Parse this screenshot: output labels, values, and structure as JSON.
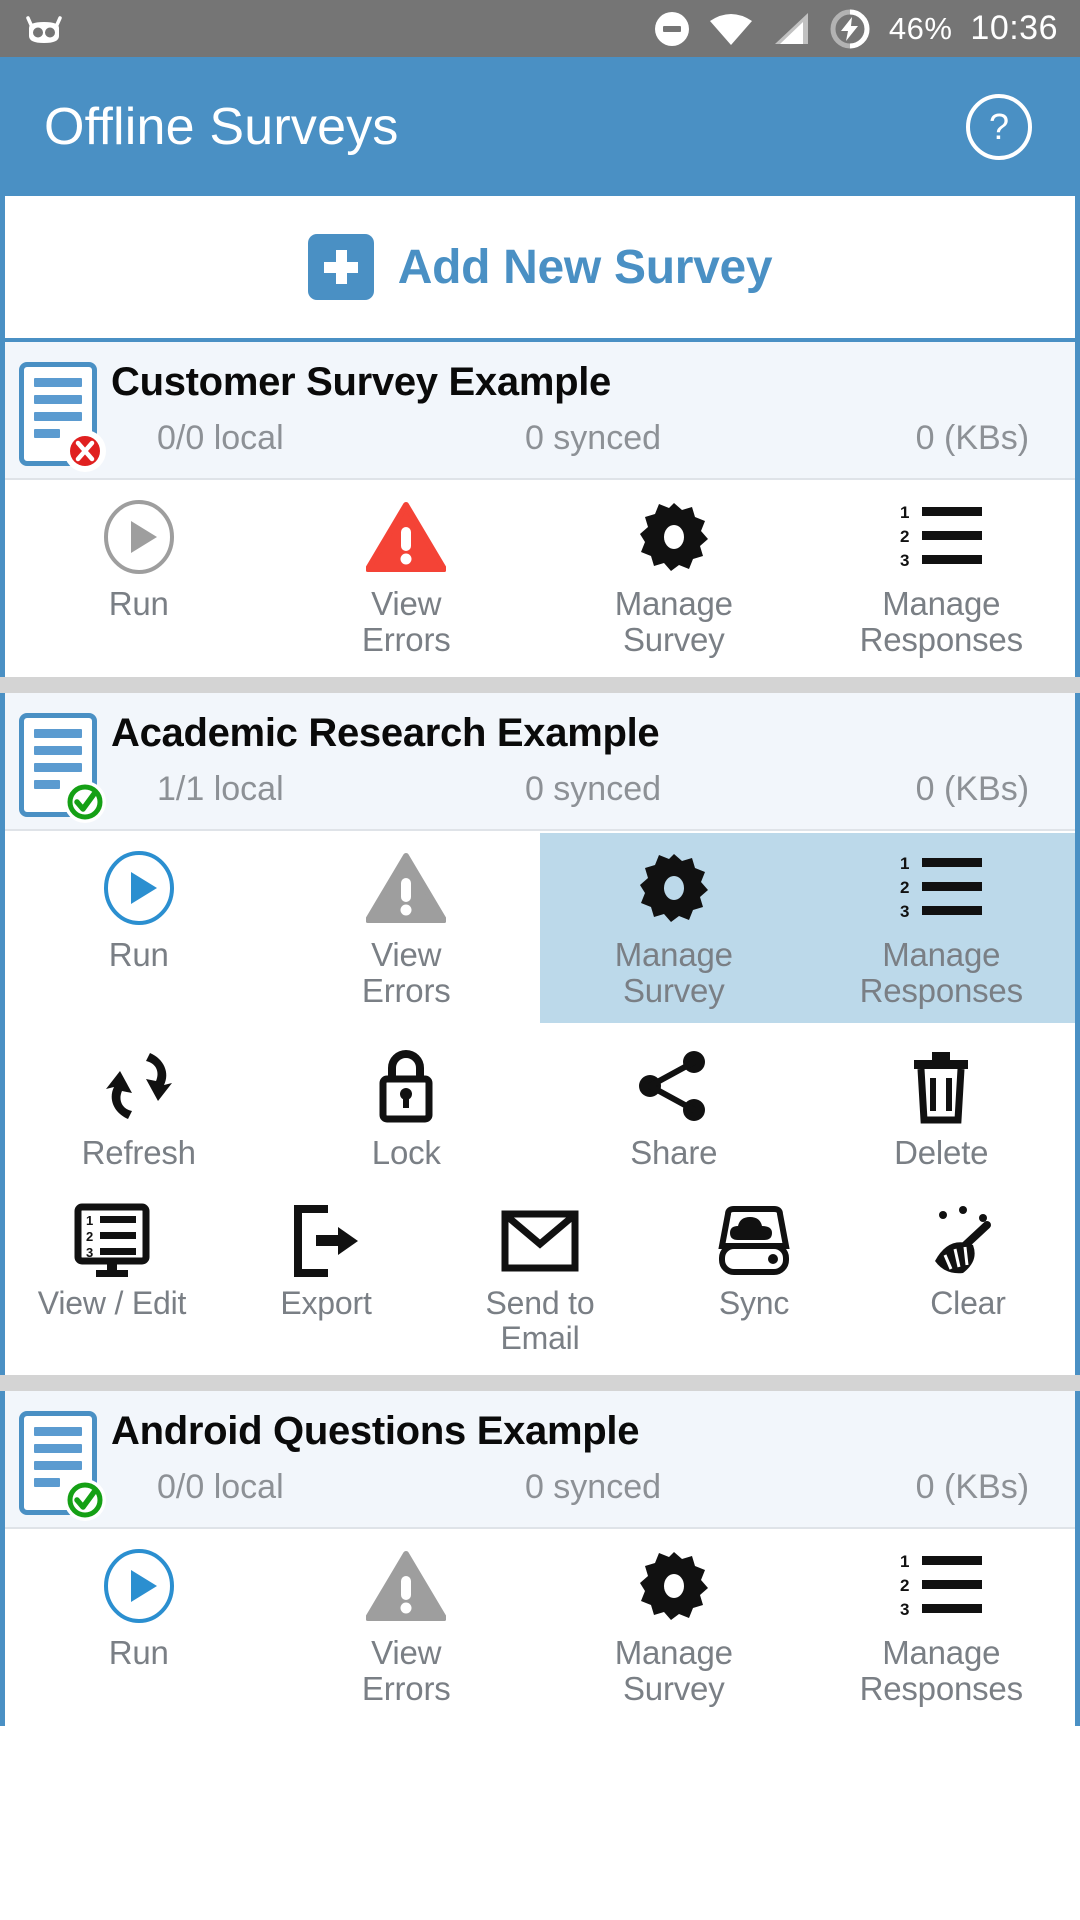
{
  "status_bar": {
    "cm_logo_icon": "cyanogenmod-logo-icon",
    "dnd_icon": "do-not-disturb-icon",
    "wifi_icon": "wifi-icon",
    "signal_icon": "cellular-signal-icon",
    "battery_icon": "battery-charging-icon",
    "battery_percent": "46%",
    "time": "10:36"
  },
  "appbar": {
    "title": "Offline Surveys",
    "help_label": "?",
    "help_icon": "help-circle-icon",
    "bg_color": "#4a90c4"
  },
  "add_survey": {
    "label": "Add New Survey",
    "plus_icon": "plus-box-icon",
    "accent_color": "#4a90c4"
  },
  "labels": {
    "run": "Run",
    "view_errors": "View\nErrors",
    "view_errors_l1": "View",
    "view_errors_l2": "Errors",
    "manage_survey_l1": "Manage",
    "manage_survey_l2": "Survey",
    "manage_responses_l1": "Manage",
    "manage_responses_l2": "Responses",
    "refresh": "Refresh",
    "lock": "Lock",
    "share": "Share",
    "delete": "Delete",
    "view_edit": "View / Edit",
    "export": "Export",
    "send_email_l1": "Send to",
    "send_email_l2": "Email",
    "sync": "Sync",
    "clear": "Clear"
  },
  "colors": {
    "accent": "#4a90c4",
    "selected_bg": "#bcd9ea",
    "error_red": "#f44336",
    "disabled_gray": "#9e9e9e",
    "ok_green": "#15a015",
    "card_head_bg": "#f2f6fb",
    "label_gray": "#7a7f85"
  },
  "surveys": [
    {
      "title": "Customer Survey Example",
      "local": "0/0 local",
      "synced": "0 synced",
      "size": "0 (KBs)",
      "status_badge": "error",
      "doc_icon": "survey-document-icon",
      "expanded": false,
      "run_enabled": false,
      "errors_state": "error"
    },
    {
      "title": "Academic Research Example",
      "local": "1/1 local",
      "synced": "0 synced",
      "size": "0 (KBs)",
      "status_badge": "ok",
      "doc_icon": "survey-document-icon",
      "expanded": true,
      "run_enabled": true,
      "errors_state": "disabled"
    },
    {
      "title": "Android Questions Example",
      "local": "0/0 local",
      "synced": "0 synced",
      "size": "0 (KBs)",
      "status_badge": "ok",
      "doc_icon": "survey-document-icon",
      "expanded": false,
      "run_enabled": true,
      "errors_state": "disabled"
    }
  ]
}
